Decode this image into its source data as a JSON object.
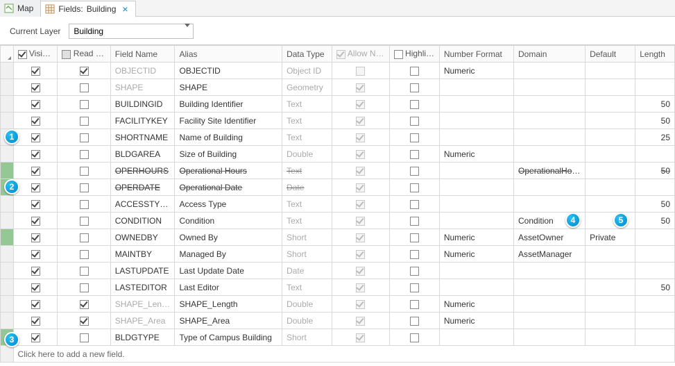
{
  "tabs": {
    "map": "Map",
    "fields_prefix": "Fields:",
    "fields_item": "Building"
  },
  "layerbar": {
    "label": "Current Layer",
    "value": "Building"
  },
  "columns": {
    "visible": "Visible",
    "readonly": "Read Only",
    "fieldname": "Field Name",
    "alias": "Alias",
    "datatype": "Data Type",
    "allownull": "Allow NULL",
    "highlight": "Highlight",
    "numberformat": "Number Format",
    "domain": "Domain",
    "default": "Default",
    "length": "Length"
  },
  "rows": [
    {
      "green": false,
      "strike": false,
      "visible": true,
      "readonly": true,
      "fnDisabled": true,
      "fieldname": "OBJECTID",
      "alias": "OBJECTID",
      "dtDisabled": true,
      "datatype": "Object ID",
      "allownull": false,
      "highlight": false,
      "numberformat": "Numeric",
      "domain": "",
      "default": "",
      "length": ""
    },
    {
      "green": false,
      "strike": false,
      "visible": true,
      "readonly": false,
      "fnDisabled": true,
      "fieldname": "SHAPE",
      "alias": "SHAPE",
      "dtDisabled": true,
      "datatype": "Geometry",
      "allownull": true,
      "highlight": false,
      "numberformat": "",
      "domain": "",
      "default": "",
      "length": ""
    },
    {
      "green": false,
      "strike": false,
      "visible": true,
      "readonly": false,
      "fnDisabled": false,
      "fieldname": "BUILDINGID",
      "alias": "Building Identifier",
      "dtDisabled": true,
      "datatype": "Text",
      "allownull": true,
      "highlight": false,
      "numberformat": "",
      "domain": "",
      "default": "",
      "length": "50"
    },
    {
      "green": false,
      "strike": false,
      "visible": true,
      "readonly": false,
      "fnDisabled": false,
      "fieldname": "FACILITYKEY",
      "alias": "Facility Site Identifier",
      "dtDisabled": true,
      "datatype": "Text",
      "allownull": true,
      "highlight": false,
      "numberformat": "",
      "domain": "",
      "default": "",
      "length": "50"
    },
    {
      "green": false,
      "strike": false,
      "visible": true,
      "readonly": false,
      "fnDisabled": false,
      "fieldname": "SHORTNAME",
      "alias": "Name of Building",
      "dtDisabled": true,
      "datatype": "Text",
      "allownull": true,
      "highlight": false,
      "numberformat": "",
      "domain": "",
      "default": "",
      "length": "25"
    },
    {
      "green": false,
      "strike": false,
      "visible": true,
      "readonly": false,
      "fnDisabled": false,
      "fieldname": "BLDGAREA",
      "alias": "Size of Building",
      "dtDisabled": true,
      "datatype": "Double",
      "allownull": true,
      "highlight": false,
      "numberformat": "Numeric",
      "domain": "",
      "default": "",
      "length": ""
    },
    {
      "green": true,
      "strike": true,
      "visible": true,
      "readonly": false,
      "fnDisabled": false,
      "fieldname": "OPERHOURS",
      "alias": "Operational Hours",
      "dtDisabled": true,
      "datatype": "Text",
      "allownull": true,
      "highlight": false,
      "numberformat": "",
      "domain": "OperationalHours",
      "default": "",
      "length": "50"
    },
    {
      "green": true,
      "strike": true,
      "visible": true,
      "readonly": false,
      "fnDisabled": false,
      "fieldname": "OPERDATE",
      "alias": "Operational Date",
      "dtDisabled": true,
      "datatype": "Date",
      "allownull": true,
      "highlight": false,
      "numberformat": "",
      "domain": "",
      "default": "",
      "length": ""
    },
    {
      "green": false,
      "strike": false,
      "visible": true,
      "readonly": false,
      "fnDisabled": false,
      "fieldname": "ACCESSTYPE",
      "alias": "Access Type",
      "dtDisabled": true,
      "datatype": "Text",
      "allownull": true,
      "highlight": false,
      "numberformat": "",
      "domain": "",
      "default": "",
      "length": "50"
    },
    {
      "green": false,
      "strike": false,
      "visible": true,
      "readonly": false,
      "fnDisabled": false,
      "fieldname": "CONDITION",
      "alias": "Condition",
      "dtDisabled": true,
      "datatype": "Text",
      "allownull": true,
      "highlight": false,
      "numberformat": "",
      "domain": "Condition",
      "default": "",
      "length": "50"
    },
    {
      "green": true,
      "strike": false,
      "visible": true,
      "readonly": false,
      "fnDisabled": false,
      "fieldname": "OWNEDBY",
      "alias": "Owned By",
      "dtDisabled": true,
      "datatype": "Short",
      "allownull": true,
      "highlight": false,
      "numberformat": "Numeric",
      "domain": "AssetOwner",
      "default": "Private",
      "length": ""
    },
    {
      "green": false,
      "strike": false,
      "visible": true,
      "readonly": false,
      "fnDisabled": false,
      "fieldname": "MAINTBY",
      "alias": "Managed By",
      "dtDisabled": true,
      "datatype": "Short",
      "allownull": true,
      "highlight": false,
      "numberformat": "Numeric",
      "domain": "AssetManager",
      "default": "",
      "length": ""
    },
    {
      "green": false,
      "strike": false,
      "visible": true,
      "readonly": false,
      "fnDisabled": false,
      "fieldname": "LASTUPDATE",
      "alias": "Last Update Date",
      "dtDisabled": true,
      "datatype": "Date",
      "allownull": true,
      "highlight": false,
      "numberformat": "",
      "domain": "",
      "default": "",
      "length": ""
    },
    {
      "green": false,
      "strike": false,
      "visible": true,
      "readonly": false,
      "fnDisabled": false,
      "fieldname": "LASTEDITOR",
      "alias": "Last Editor",
      "dtDisabled": true,
      "datatype": "Text",
      "allownull": true,
      "highlight": false,
      "numberformat": "",
      "domain": "",
      "default": "",
      "length": "50"
    },
    {
      "green": false,
      "strike": false,
      "visible": true,
      "readonly": true,
      "fnDisabled": true,
      "fieldname": "SHAPE_Length",
      "alias": "SHAPE_Length",
      "dtDisabled": true,
      "datatype": "Double",
      "allownull": true,
      "highlight": false,
      "numberformat": "Numeric",
      "domain": "",
      "default": "",
      "length": ""
    },
    {
      "green": false,
      "strike": false,
      "visible": true,
      "readonly": true,
      "fnDisabled": true,
      "fieldname": "SHAPE_Area",
      "alias": "SHAPE_Area",
      "dtDisabled": true,
      "datatype": "Double",
      "allownull": true,
      "highlight": false,
      "numberformat": "Numeric",
      "domain": "",
      "default": "",
      "length": ""
    },
    {
      "green": true,
      "strike": false,
      "visible": true,
      "readonly": false,
      "fnDisabled": false,
      "fieldname": "BLDGTYPE",
      "alias": "Type of Campus Building",
      "dtDisabled": true,
      "datatype": "Short",
      "allownull": true,
      "highlight": false,
      "numberformat": "",
      "domain": "",
      "default": "",
      "length": ""
    }
  ],
  "add_new_text": "Click here to add a new field.",
  "callouts": {
    "c1": "1",
    "c2": "2",
    "c3": "3",
    "c4": "4",
    "c5": "5"
  }
}
